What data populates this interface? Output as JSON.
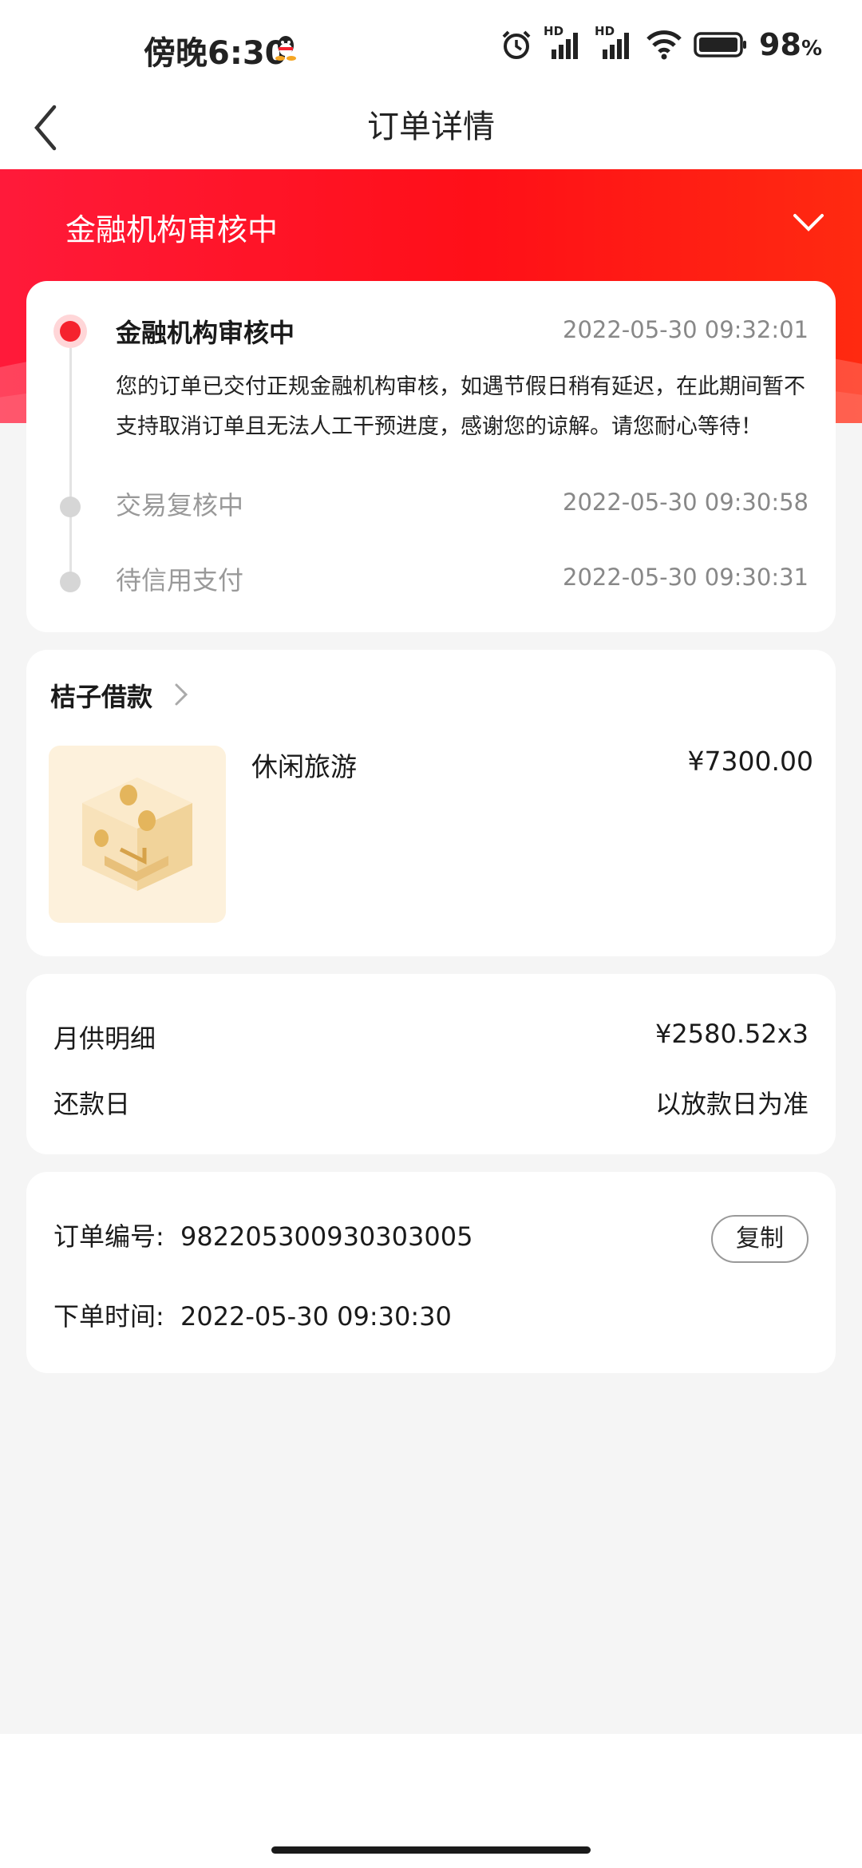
{
  "status_bar": {
    "time": "傍晚6:30",
    "battery": "98",
    "battery_unit": "%",
    "net_label_1": "HD",
    "net_label_2": "HD",
    "icons": [
      "qq-icon",
      "alarm-icon",
      "signal-icon",
      "signal-icon",
      "wifi-icon",
      "battery-icon"
    ]
  },
  "nav": {
    "title": "订单详情",
    "back_icon": "back-chevron-icon"
  },
  "banner": {
    "status": "金融机构审核中",
    "toggle_icon": "chevron-down-icon"
  },
  "timeline": [
    {
      "title": "金融机构审核中",
      "time": "2022-05-30 09:32:01",
      "desc": "您的订单已交付正规金融机构审核，如遇节假日稍有延迟，在此期间暂不支持取消订单且无法人工干预进度，感谢您的谅解。请您耐心等待！",
      "active": true
    },
    {
      "title": "交易复核中",
      "time": "2022-05-30 09:30:58",
      "active": false
    },
    {
      "title": "待信用支付",
      "time": "2022-05-30 09:30:31",
      "active": false
    }
  ],
  "merchant": {
    "name": "桔子借款",
    "product_name": "休闲旅游",
    "product_price": "¥7300.00"
  },
  "repayment": {
    "monthly_label": "月供明细",
    "monthly_value": "¥2580.52x3",
    "due_label": "还款日",
    "due_value": "以放款日为准"
  },
  "order_info": {
    "number_label": "订单编号:",
    "number_value": "982205300930303005",
    "copy_label": "复制",
    "time_label": "下单时间:",
    "time_value": "2022-05-30 09:30:30"
  },
  "colors": {
    "brand_red": "#ff1a24",
    "active_dot": "#f5222d",
    "background": "#f5f5f5"
  }
}
